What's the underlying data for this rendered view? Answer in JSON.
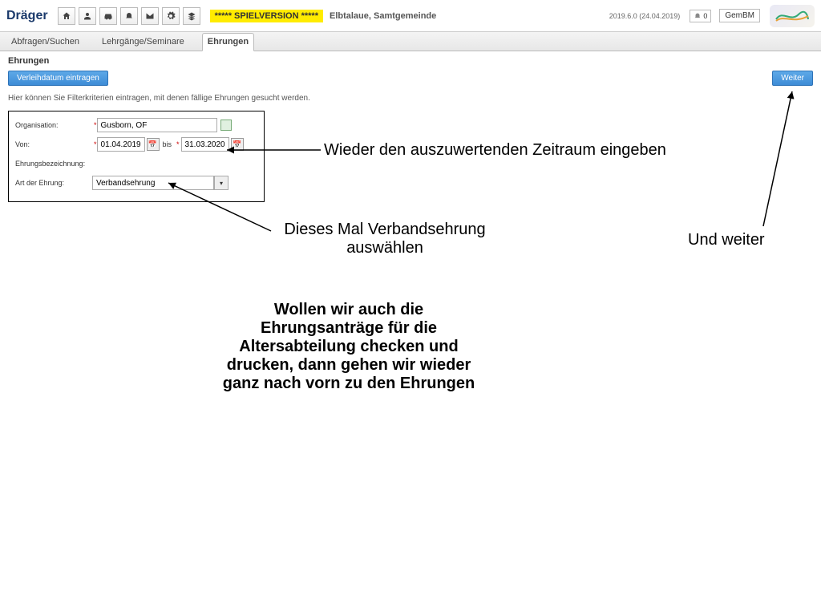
{
  "header": {
    "logo_text": "Dräger",
    "version_badge": "***** SPIELVERSION *****",
    "subtitle": "Elbtalaue, Samtgemeinde",
    "version_text": "2019.6.0 (24.04.2019)",
    "notif_count": "0",
    "user_label": "GemBM"
  },
  "tabs": {
    "t0": "Abfragen/Suchen",
    "t1": "Lehrgänge/Seminare",
    "t2": "Ehrungen"
  },
  "page": {
    "title": "Ehrungen",
    "hint": "Hier können Sie Filterkriterien eintragen, mit denen fällige Ehrungen gesucht werden."
  },
  "buttons": {
    "enter": "Verleihdatum eintragen",
    "next": "Weiter"
  },
  "filter": {
    "label_org": "Organisation:",
    "value_org": "Gusborn, OF",
    "label_von": "Von:",
    "value_von": "01.04.2019",
    "bis": "bis",
    "value_bis": "31.03.2020",
    "label_bez": "Ehrungsbezeichnung:",
    "label_art": "Art der Ehrung:",
    "value_art": "Verbandsehrung"
  },
  "annotations": {
    "a1": "Wieder den auszuwertenden Zeitraum eingeben",
    "a2": "Dieses Mal Verbandsehrung auswählen",
    "a3": "Und weiter",
    "a4": "Wollen wir auch die Ehrungsanträge für die Altersabteilung checken und drucken, dann gehen wir wieder ganz nach vorn zu den Ehrungen"
  }
}
